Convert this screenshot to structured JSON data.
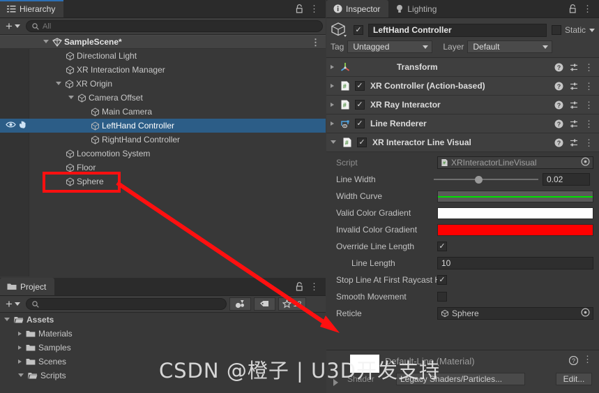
{
  "hierarchy": {
    "tab_label": "Hierarchy",
    "lock_icon": "lock-icon",
    "menu_icon": "kebab-menu-icon",
    "add_label": "+",
    "search_placeholder": "All",
    "search_value": "",
    "rows": [
      {
        "label": "SampleScene*",
        "depth": 1,
        "twisty": "open",
        "type": "scene"
      },
      {
        "label": "Directional Light",
        "depth": 2,
        "twisty": "none",
        "type": "object"
      },
      {
        "label": "XR Interaction Manager",
        "depth": 2,
        "twisty": "none",
        "type": "object"
      },
      {
        "label": "XR Origin",
        "depth": 2,
        "twisty": "open",
        "type": "object"
      },
      {
        "label": "Camera Offset",
        "depth": 3,
        "twisty": "open",
        "type": "object"
      },
      {
        "label": "Main Camera",
        "depth": 4,
        "twisty": "none",
        "type": "object"
      },
      {
        "label": "LeftHand Controller",
        "depth": 4,
        "twisty": "none",
        "type": "object",
        "selected": true
      },
      {
        "label": "RightHand Controller",
        "depth": 4,
        "twisty": "none",
        "type": "object"
      },
      {
        "label": "Locomotion System",
        "depth": 2,
        "twisty": "none",
        "type": "object"
      },
      {
        "label": "Floor",
        "depth": 2,
        "twisty": "none",
        "type": "object"
      },
      {
        "label": "Sphere",
        "depth": 2,
        "twisty": "none",
        "type": "object",
        "highlighted": true
      }
    ]
  },
  "project": {
    "tab_label": "Project",
    "lock_icon": "lock-icon",
    "menu_icon": "kebab-menu-icon",
    "add_label": "+",
    "search_placeholder": "",
    "search_value": "",
    "favorites_count": "18",
    "rows": [
      {
        "label": "Assets",
        "depth": 0,
        "twisty": "open"
      },
      {
        "label": "Materials",
        "depth": 1,
        "twisty": "closed"
      },
      {
        "label": "Samples",
        "depth": 1,
        "twisty": "closed"
      },
      {
        "label": "Scenes",
        "depth": 1,
        "twisty": "closed"
      },
      {
        "label": "Scripts",
        "depth": 1,
        "twisty": "open"
      }
    ]
  },
  "inspector": {
    "tabs": [
      {
        "label": "Inspector",
        "icon": "info-icon",
        "active": true
      },
      {
        "label": "Lighting",
        "icon": "bulb-icon",
        "active": false
      }
    ],
    "lock_icon": "lock-icon",
    "menu_icon": "kebab-menu-icon",
    "object_name": "LeftHand Controller",
    "object_enabled": true,
    "static_label": "Static",
    "static_checked": false,
    "tag_label": "Tag",
    "tag_value": "Untagged",
    "layer_label": "Layer",
    "layer_value": "Default",
    "components": [
      {
        "name": "Transform",
        "icon": "transform-icon",
        "expanded": false,
        "has_toggle": false
      },
      {
        "name": "XR Controller (Action-based)",
        "icon": "script-icon",
        "expanded": false,
        "has_toggle": true,
        "enabled": true
      },
      {
        "name": "XR Ray Interactor",
        "icon": "script-icon",
        "expanded": false,
        "has_toggle": true,
        "enabled": true
      },
      {
        "name": "Line Renderer",
        "icon": "line-renderer-icon",
        "expanded": false,
        "has_toggle": true,
        "enabled": true
      },
      {
        "name": "XR Interactor Line Visual",
        "icon": "script-icon",
        "expanded": true,
        "has_toggle": true,
        "enabled": true
      }
    ],
    "properties": [
      {
        "label": "Script",
        "kind": "object",
        "value": "XRInteractorLineVisual",
        "dim": true
      },
      {
        "label": "Line Width",
        "kind": "slider",
        "value": "0.02"
      },
      {
        "label": "Width Curve",
        "kind": "curve",
        "curve_color": "#00e000"
      },
      {
        "label": "Valid Color Gradient",
        "kind": "gradient",
        "color": "#ffffff"
      },
      {
        "label": "Invalid Color Gradient",
        "kind": "gradient",
        "color": "#ff0000"
      },
      {
        "label": "Override Line Length",
        "kind": "check",
        "checked": true
      },
      {
        "label": "Line Length",
        "kind": "number",
        "value": "10",
        "indent": true
      },
      {
        "label": "Stop Line At First Raycast Hit",
        "kind": "check",
        "checked": true
      },
      {
        "label": "Smooth Movement",
        "kind": "check",
        "checked": false
      },
      {
        "label": "Reticle",
        "kind": "object",
        "value": "Sphere"
      }
    ],
    "material_preview": {
      "title": "Default-Line (Material)",
      "shader_label": "Shader",
      "shader_value": "Legacy Shaders/Particles...",
      "edit_label": "Edit...",
      "help_icon": "help-icon",
      "menu_icon": "kebab-menu-icon"
    }
  },
  "annotations": {
    "highlight_color": "#ff1010",
    "arrow_color": "#ff1010",
    "watermark": "CSDN @橙子 | U3D开发支持"
  }
}
